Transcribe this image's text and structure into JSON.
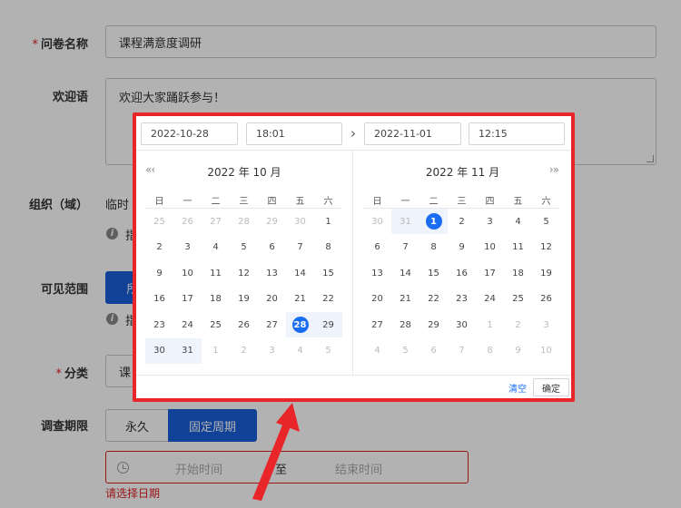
{
  "form": {
    "title_label": "问卷名称",
    "title_value": "课程满意度调研",
    "welcome_label": "欢迎语",
    "welcome_value": "欢迎大家踊跃参与！",
    "org_label": "组织（域）",
    "org_value": "临时",
    "org_hint": "指",
    "scope_label": "可见范围",
    "scope_button": "所",
    "scope_hint": "指",
    "category_label": "分类",
    "category_value": "课",
    "period_label": "调查期限",
    "period_option_forever": "永久",
    "period_option_fixed": "固定周期",
    "range_start_placeholder": "开始时间",
    "range_separator": "至",
    "range_end_placeholder": "结束时间",
    "range_error": "请选择日期",
    "required_mark": "*"
  },
  "picker": {
    "start_date": "2022-10-28",
    "start_time": "18:01",
    "end_date": "2022-11-01",
    "end_time": "12:15",
    "separator_icon": "chevron-right-icon",
    "prev_icon": "double-chevron-left-icon",
    "next_icon": "double-chevron-right-icon",
    "weekdays": [
      "日",
      "一",
      "二",
      "三",
      "四",
      "五",
      "六"
    ],
    "left_month_title": "2022 年 10 月",
    "right_month_title": "2022 年 11 月",
    "left_nav": "«‹",
    "right_nav": "›»",
    "left_days": [
      [
        {
          "d": "25",
          "m": true
        },
        {
          "d": "26",
          "m": true
        },
        {
          "d": "27",
          "m": true
        },
        {
          "d": "28",
          "m": true
        },
        {
          "d": "29",
          "m": true
        },
        {
          "d": "30",
          "m": true
        },
        {
          "d": "1"
        }
      ],
      [
        {
          "d": "2"
        },
        {
          "d": "3"
        },
        {
          "d": "4"
        },
        {
          "d": "5"
        },
        {
          "d": "6"
        },
        {
          "d": "7"
        },
        {
          "d": "8"
        }
      ],
      [
        {
          "d": "9"
        },
        {
          "d": "10"
        },
        {
          "d": "11"
        },
        {
          "d": "12"
        },
        {
          "d": "13"
        },
        {
          "d": "14"
        },
        {
          "d": "15"
        }
      ],
      [
        {
          "d": "16"
        },
        {
          "d": "17"
        },
        {
          "d": "18"
        },
        {
          "d": "19"
        },
        {
          "d": "20"
        },
        {
          "d": "21"
        },
        {
          "d": "22"
        }
      ],
      [
        {
          "d": "23"
        },
        {
          "d": "24"
        },
        {
          "d": "25"
        },
        {
          "d": "26"
        },
        {
          "d": "27"
        },
        {
          "d": "28",
          "sel": true
        },
        {
          "d": "29",
          "r": true
        }
      ],
      [
        {
          "d": "30",
          "r": true
        },
        {
          "d": "31",
          "r": true
        },
        {
          "d": "1",
          "m": true
        },
        {
          "d": "2",
          "m": true
        },
        {
          "d": "3",
          "m": true
        },
        {
          "d": "4",
          "m": true
        },
        {
          "d": "5",
          "m": true
        }
      ]
    ],
    "right_days": [
      [
        {
          "d": "30",
          "m": true
        },
        {
          "d": "31",
          "m": true,
          "r": true
        },
        {
          "d": "1",
          "sel": true
        },
        {
          "d": "2"
        },
        {
          "d": "3"
        },
        {
          "d": "4"
        },
        {
          "d": "5"
        }
      ],
      [
        {
          "d": "6"
        },
        {
          "d": "7"
        },
        {
          "d": "8"
        },
        {
          "d": "9"
        },
        {
          "d": "10"
        },
        {
          "d": "11"
        },
        {
          "d": "12"
        }
      ],
      [
        {
          "d": "13"
        },
        {
          "d": "14"
        },
        {
          "d": "15"
        },
        {
          "d": "16"
        },
        {
          "d": "17"
        },
        {
          "d": "18"
        },
        {
          "d": "19"
        }
      ],
      [
        {
          "d": "20"
        },
        {
          "d": "21"
        },
        {
          "d": "22"
        },
        {
          "d": "23"
        },
        {
          "d": "24"
        },
        {
          "d": "25"
        },
        {
          "d": "26"
        }
      ],
      [
        {
          "d": "27"
        },
        {
          "d": "28"
        },
        {
          "d": "29"
        },
        {
          "d": "30"
        },
        {
          "d": "1",
          "m": true
        },
        {
          "d": "2",
          "m": true
        },
        {
          "d": "3",
          "m": true
        }
      ],
      [
        {
          "d": "4",
          "m": true
        },
        {
          "d": "5",
          "m": true
        },
        {
          "d": "6",
          "m": true
        },
        {
          "d": "7",
          "m": true
        },
        {
          "d": "8",
          "m": true
        },
        {
          "d": "9",
          "m": true
        },
        {
          "d": "10",
          "m": true
        }
      ]
    ],
    "clear_label": "清空",
    "ok_label": "确定"
  },
  "colors": {
    "accent": "#1a5fd8",
    "highlight_border": "#e8262a",
    "error": "#e02020"
  },
  "annotation": {
    "arrow_icon": "red-arrow-annotation-icon"
  }
}
